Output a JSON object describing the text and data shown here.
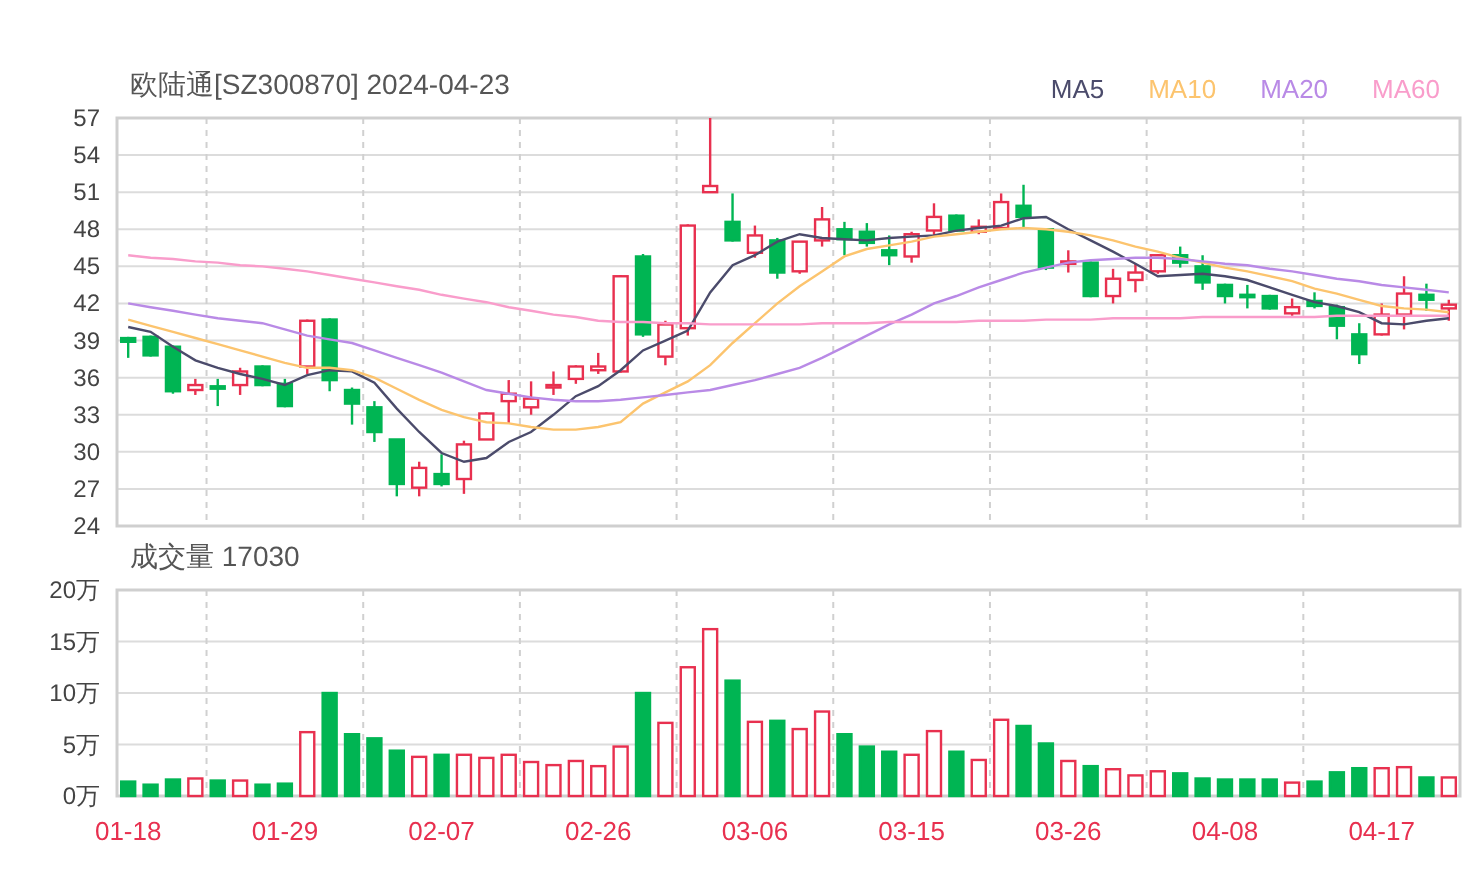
{
  "price_chart": {
    "title": "欧陆通[SZ300870] 2024-04-23",
    "candles": {
      "chart_data": {
        "type": "candlestick",
        "grid": true,
        "ylim": [
          24,
          57
        ],
        "yticks": [
          24,
          27,
          30,
          33,
          36,
          39,
          42,
          45,
          48,
          51,
          54,
          57
        ],
        "ohlc": [
          [
            39.2,
            39.3,
            37.6,
            38.9
          ],
          [
            39.3,
            39.4,
            37.7,
            37.8
          ],
          [
            38.5,
            38.6,
            34.7,
            34.9
          ],
          [
            35.0,
            35.9,
            34.6,
            35.4
          ],
          [
            35.3,
            35.9,
            33.7,
            35.2
          ],
          [
            35.4,
            36.8,
            34.6,
            36.5
          ],
          [
            36.9,
            37.0,
            35.3,
            35.4
          ],
          [
            35.5,
            35.9,
            33.6,
            33.7
          ],
          [
            36.9,
            40.7,
            36.3,
            40.6
          ],
          [
            40.7,
            40.8,
            34.9,
            35.8
          ],
          [
            35.0,
            35.2,
            32.2,
            33.9
          ],
          [
            33.6,
            34.1,
            30.8,
            31.6
          ],
          [
            31.0,
            31.0,
            26.4,
            27.4
          ],
          [
            27.1,
            29.2,
            26.4,
            28.7
          ],
          [
            28.2,
            29.8,
            27.2,
            27.4
          ],
          [
            27.8,
            30.9,
            26.6,
            30.6
          ],
          [
            31.0,
            33.2,
            31.0,
            33.1
          ],
          [
            34.1,
            35.8,
            32.3,
            34.7
          ],
          [
            33.6,
            35.7,
            33.0,
            34.3
          ],
          [
            35.2,
            36.5,
            34.6,
            35.4
          ],
          [
            35.9,
            37.0,
            35.5,
            36.9
          ],
          [
            36.6,
            38.0,
            36.3,
            36.9
          ],
          [
            36.5,
            44.3,
            36.4,
            44.2
          ],
          [
            45.8,
            46.0,
            39.3,
            39.5
          ],
          [
            37.7,
            40.6,
            37.0,
            40.3
          ],
          [
            40.0,
            48.4,
            39.4,
            48.3
          ],
          [
            51.0,
            57.0,
            51.0,
            51.5
          ],
          [
            48.6,
            50.9,
            47.0,
            47.1
          ],
          [
            46.1,
            48.3,
            45.7,
            47.5
          ],
          [
            47.1,
            47.3,
            44.0,
            44.5
          ],
          [
            44.6,
            47.0,
            44.4,
            47.0
          ],
          [
            47.1,
            49.8,
            46.6,
            48.8
          ],
          [
            48.0,
            48.6,
            45.9,
            47.2
          ],
          [
            47.8,
            48.5,
            46.6,
            46.9
          ],
          [
            46.3,
            47.5,
            45.1,
            45.9
          ],
          [
            45.8,
            47.8,
            45.3,
            47.6
          ],
          [
            47.9,
            50.1,
            47.5,
            49.0
          ],
          [
            49.1,
            49.2,
            47.8,
            47.9
          ],
          [
            47.8,
            48.8,
            47.6,
            48.2
          ],
          [
            48.1,
            50.9,
            48.0,
            50.2
          ],
          [
            49.9,
            51.6,
            48.1,
            49.0
          ],
          [
            48.0,
            48.1,
            44.7,
            44.9
          ],
          [
            45.3,
            46.3,
            44.5,
            45.4
          ],
          [
            45.3,
            45.4,
            42.5,
            42.6
          ],
          [
            42.6,
            44.8,
            42.0,
            44.0
          ],
          [
            43.9,
            45.2,
            42.9,
            44.5
          ],
          [
            44.6,
            46.0,
            44.4,
            45.9
          ],
          [
            45.9,
            46.6,
            44.9,
            45.3
          ],
          [
            45.0,
            45.9,
            43.1,
            43.7
          ],
          [
            43.5,
            43.6,
            42.0,
            42.6
          ],
          [
            42.7,
            43.5,
            41.6,
            42.6
          ],
          [
            42.6,
            42.7,
            41.5,
            41.6
          ],
          [
            41.2,
            42.4,
            41.0,
            41.7
          ],
          [
            42.2,
            42.9,
            41.6,
            41.8
          ],
          [
            41.7,
            41.9,
            39.1,
            40.2
          ],
          [
            39.5,
            40.4,
            37.1,
            37.9
          ],
          [
            39.5,
            42.0,
            39.4,
            41.1
          ],
          [
            41.1,
            44.2,
            39.9,
            42.8
          ],
          [
            42.7,
            43.6,
            41.4,
            42.3
          ],
          [
            41.6,
            42.3,
            40.6,
            41.9
          ]
        ]
      }
    },
    "moving_averages": {
      "chart_data": {
        "type": "line",
        "ylim": [
          24,
          57
        ],
        "series": [
          {
            "name": "MA5",
            "color": "#4b4b6b",
            "values": [
              40.1,
              39.7,
              38.5,
              37.4,
              36.8,
              36.3,
              35.9,
              35.4,
              36.2,
              36.6,
              36.5,
              35.6,
              33.5,
              31.6,
              29.9,
              29.2,
              29.5,
              30.8,
              31.6,
              33.0,
              34.5,
              35.3,
              36.6,
              38.2,
              39.0,
              39.8,
              42.9,
              45.1,
              45.9,
              47.0,
              47.6,
              47.3,
              47.2,
              47.1,
              47.3,
              47.4,
              47.5,
              47.9,
              48.1,
              48.3,
              48.9,
              49.0,
              48.0,
              47.1,
              46.2,
              45.2,
              44.2,
              44.3,
              44.4,
              44.2,
              43.9,
              43.3,
              42.7,
              42.1,
              41.8,
              41.3,
              40.4,
              40.3,
              40.6,
              40.8
            ]
          },
          {
            "name": "MA10",
            "color": "#fcc46e",
            "values": [
              40.7,
              40.2,
              39.7,
              39.2,
              38.7,
              38.2,
              37.7,
              37.2,
              36.8,
              36.8,
              36.6,
              36.0,
              35.1,
              34.2,
              33.4,
              32.8,
              32.4,
              32.3,
              32.0,
              31.8,
              31.8,
              32.0,
              32.4,
              33.9,
              34.8,
              35.7,
              37.0,
              38.8,
              40.4,
              42.0,
              43.4,
              44.6,
              45.8,
              46.4,
              46.7,
              47.0,
              47.4,
              47.6,
              47.8,
              48.0,
              48.1,
              48.0,
              47.8,
              47.5,
              47.1,
              46.6,
              46.2,
              45.7,
              45.3,
              44.9,
              44.6,
              44.2,
              43.8,
              43.2,
              42.8,
              42.3,
              41.8,
              41.6,
              41.5,
              41.3
            ]
          },
          {
            "name": "MA20",
            "color": "#b98ae6",
            "values": [
              42.0,
              41.7,
              41.4,
              41.1,
              40.8,
              40.6,
              40.4,
              39.9,
              39.4,
              39.1,
              38.8,
              38.2,
              37.6,
              37.0,
              36.4,
              35.7,
              35.0,
              34.7,
              34.4,
              34.2,
              34.1,
              34.1,
              34.2,
              34.4,
              34.6,
              34.8,
              35.0,
              35.4,
              35.8,
              36.3,
              36.8,
              37.6,
              38.5,
              39.4,
              40.3,
              41.1,
              42.0,
              42.6,
              43.3,
              43.9,
              44.5,
              44.9,
              45.3,
              45.5,
              45.6,
              45.7,
              45.7,
              45.6,
              45.4,
              45.2,
              45.1,
              44.8,
              44.6,
              44.3,
              44.0,
              43.8,
              43.5,
              43.3,
              43.1,
              42.9
            ]
          },
          {
            "name": "MA60",
            "color": "#f99dcb",
            "values": [
              45.9,
              45.7,
              45.6,
              45.4,
              45.3,
              45.1,
              45.0,
              44.8,
              44.6,
              44.3,
              44.0,
              43.7,
              43.4,
              43.1,
              42.7,
              42.4,
              42.1,
              41.7,
              41.4,
              41.1,
              40.9,
              40.6,
              40.5,
              40.5,
              40.4,
              40.4,
              40.3,
              40.3,
              40.3,
              40.3,
              40.3,
              40.4,
              40.4,
              40.4,
              40.5,
              40.5,
              40.5,
              40.5,
              40.6,
              40.6,
              40.6,
              40.7,
              40.7,
              40.7,
              40.8,
              40.8,
              40.8,
              40.8,
              40.9,
              40.9,
              40.9,
              40.9,
              40.9,
              40.9,
              41.0,
              41.0,
              41.0,
              41.0,
              41.0,
              41.0
            ]
          }
        ]
      }
    }
  },
  "volume_chart": {
    "title": "成交量 17030",
    "chart_data": {
      "type": "bar",
      "grid": true,
      "ylim": [
        0,
        20
      ],
      "yticks": [
        {
          "value": 0,
          "label": "0万"
        },
        {
          "value": 5,
          "label": "5万"
        },
        {
          "value": 10,
          "label": "10万"
        },
        {
          "value": 15,
          "label": "15万"
        },
        {
          "value": 20,
          "label": "20万"
        }
      ],
      "categories": [
        "01-18",
        null,
        null,
        null,
        null,
        null,
        null,
        "01-29",
        null,
        null,
        null,
        null,
        null,
        null,
        "02-07",
        null,
        null,
        null,
        null,
        null,
        null,
        "02-26",
        null,
        null,
        null,
        null,
        null,
        null,
        "03-06",
        null,
        null,
        null,
        null,
        null,
        null,
        "03-15",
        null,
        null,
        null,
        null,
        null,
        null,
        "03-26",
        null,
        null,
        null,
        null,
        null,
        null,
        "04-08",
        null,
        null,
        null,
        null,
        null,
        null,
        "04-17",
        null,
        null,
        null
      ],
      "values": [
        1.4,
        1.1,
        1.6,
        1.7,
        1.5,
        1.5,
        1.1,
        1.2,
        6.2,
        10.0,
        6.0,
        5.6,
        4.4,
        3.8,
        4.0,
        4.0,
        3.7,
        4.0,
        3.3,
        3.0,
        3.4,
        2.9,
        4.8,
        10.0,
        7.1,
        12.5,
        16.2,
        11.2,
        7.2,
        7.3,
        6.5,
        8.2,
        6.0,
        4.8,
        4.3,
        4.0,
        6.3,
        4.3,
        3.5,
        7.4,
        6.8,
        5.1,
        3.4,
        2.9,
        2.6,
        2.0,
        2.4,
        2.2,
        1.7,
        1.6,
        1.6,
        1.6,
        1.3,
        1.4,
        2.3,
        2.7,
        2.7,
        2.8,
        1.8,
        1.8
      ]
    }
  }
}
